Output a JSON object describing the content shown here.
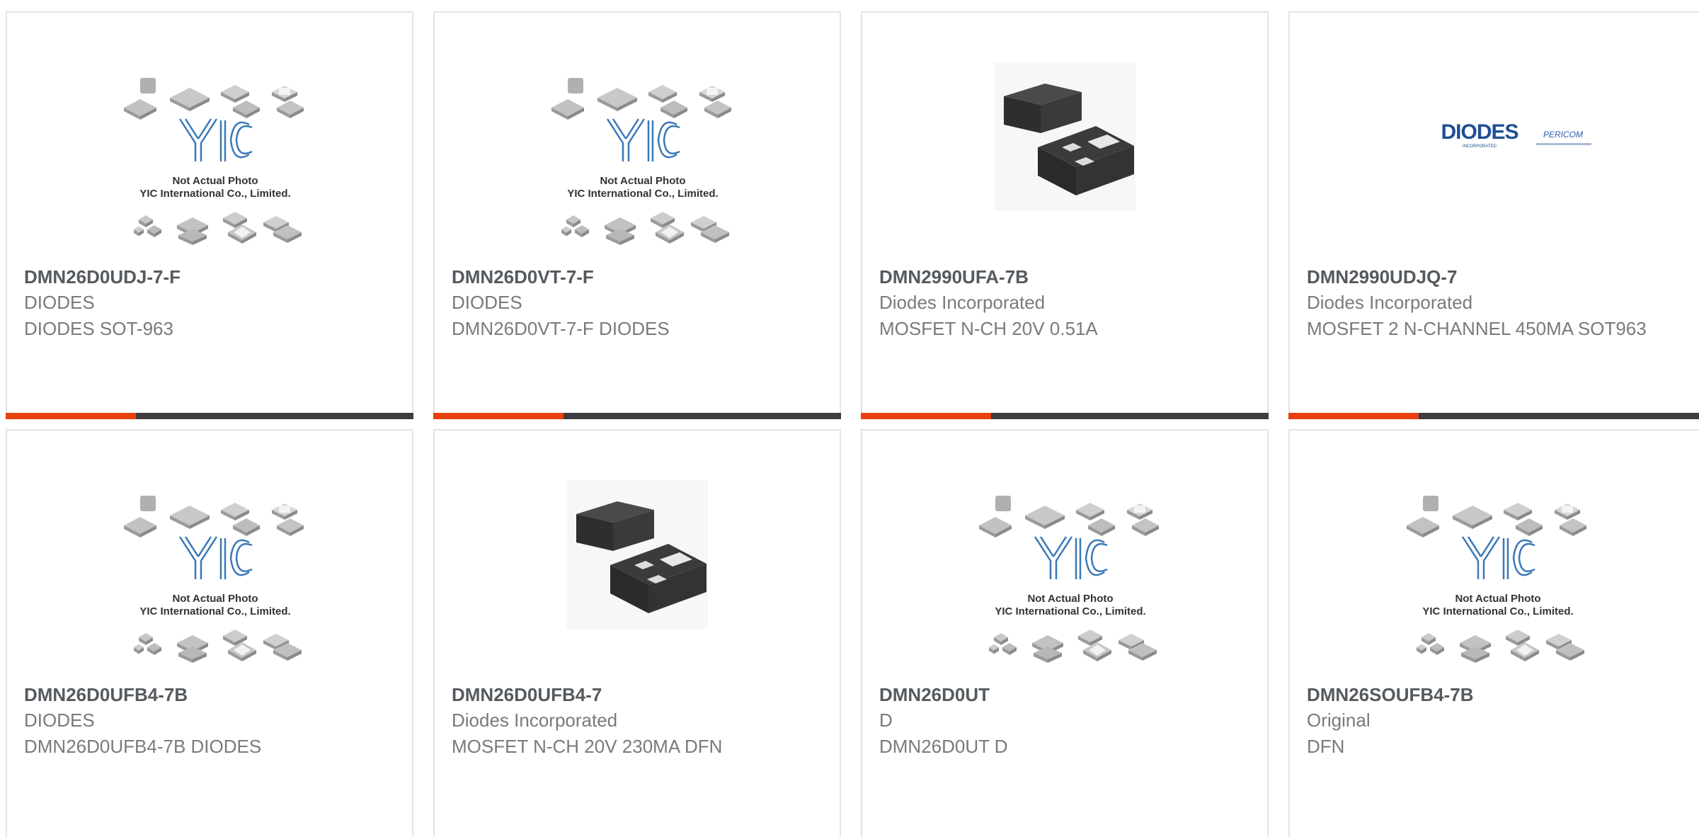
{
  "accent_color": "#e8400f",
  "bar_color": "#3d3d3d",
  "placeholder_image": {
    "brand": "YIC",
    "line1": "Not Actual Photo",
    "line2": "YIC International Co., Limited."
  },
  "diodes_logo": {
    "brand": "DIODES",
    "sub": "INCORPORATED",
    "pericom": "PERICOM"
  },
  "products": [
    {
      "part": "DMN26D0UDJ-7-F",
      "manufacturer": "DIODES",
      "description": "DIODES SOT-963",
      "image": "yic-placeholder-image"
    },
    {
      "part": "DMN26D0VT-7-F",
      "manufacturer": "DIODES",
      "description": "DMN26D0VT-7-F DIODES",
      "image": "yic-placeholder-image"
    },
    {
      "part": "DMN2990UFA-7B",
      "manufacturer": "Diodes Incorporated",
      "description": "MOSFET N-CH 20V 0.51A",
      "image": "dfn-package-photo"
    },
    {
      "part": "DMN2990UDJQ-7",
      "manufacturer": "Diodes Incorporated",
      "description": "MOSFET 2 N-CHANNEL 450MA SOT963",
      "image": "diodes-logo-image"
    },
    {
      "part": "DMN26D0UFB4-7B",
      "manufacturer": "DIODES",
      "description": "DMN26D0UFB4-7B DIODES",
      "image": "yic-placeholder-image"
    },
    {
      "part": "DMN26D0UFB4-7",
      "manufacturer": "Diodes Incorporated",
      "description": "MOSFET N-CH 20V 230MA DFN",
      "image": "dfn-package-photo"
    },
    {
      "part": "DMN26D0UT",
      "manufacturer": "D",
      "description": "DMN26D0UT D",
      "image": "yic-placeholder-image"
    },
    {
      "part": "DMN26SOUFB4-7B",
      "manufacturer": "Original",
      "description": "DFN",
      "image": "yic-placeholder-image"
    }
  ]
}
